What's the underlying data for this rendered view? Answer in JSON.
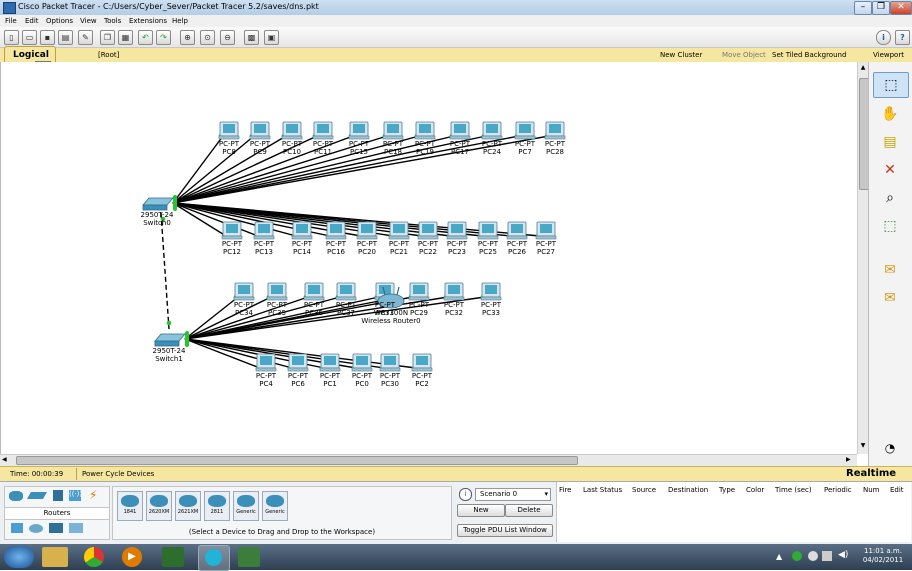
{
  "window": {
    "title": "Cisco Packet Tracer - C:/Users/Cyber_Sever/Packet Tracer 5.2/saves/dns.pkt",
    "controls": [
      "–",
      "❐",
      "✕"
    ]
  },
  "menu": [
    "File",
    "Edit",
    "Options",
    "View",
    "Tools",
    "Extensions",
    "Help"
  ],
  "toolbar": {
    "help_glyph": "?",
    "info_glyph": "i"
  },
  "logical_bar": {
    "tab_label": "Logical",
    "root_label": "[Root]",
    "new_cluster": "New Cluster",
    "move_object": "Move Object",
    "set_tiled_background": "Set Tiled Background",
    "viewport": "Viewport"
  },
  "colors": {
    "link_up": "#22c92b",
    "link_bundle": "#000000",
    "pc_screen": "#4aa8c7",
    "workspace_bar": "#f6e7a0"
  },
  "switches": [
    {
      "id": "s0",
      "line1": "2950T-24",
      "line2": "Switch0"
    },
    {
      "id": "s1",
      "line1": "2950T-24",
      "line2": "Switch1"
    }
  ],
  "router": {
    "line1": "WRT300N",
    "line2": "Wireless Router0"
  },
  "pc_rows": {
    "row1": [
      {
        "type": "PC-PT",
        "name": "PC8"
      },
      {
        "type": "PC-PT",
        "name": "PC9"
      },
      {
        "type": "PC-PT",
        "name": "PC10"
      },
      {
        "type": "PC-PT",
        "name": "PC11"
      },
      {
        "type": "PC-PT",
        "name": "PC15"
      },
      {
        "type": "PC-PT",
        "name": "PC18"
      },
      {
        "type": "PC-PT",
        "name": "PC19"
      },
      {
        "type": "PC-PT",
        "name": "PC17"
      },
      {
        "type": "PC-PT",
        "name": "PC24"
      },
      {
        "type": "PC-PT",
        "name": "PC7"
      },
      {
        "type": "PC-PT",
        "name": "PC28"
      }
    ],
    "row2": [
      {
        "type": "PC-PT",
        "name": "PC12"
      },
      {
        "type": "PC-PT",
        "name": "PC13"
      },
      {
        "type": "PC-PT",
        "name": "PC14"
      },
      {
        "type": "PC-PT",
        "name": "PC16"
      },
      {
        "type": "PC-PT",
        "name": "PC20"
      },
      {
        "type": "PC-PT",
        "name": "PC21"
      },
      {
        "type": "PC-PT",
        "name": "PC22"
      },
      {
        "type": "PC-PT",
        "name": "PC23"
      },
      {
        "type": "PC-PT",
        "name": "PC25"
      },
      {
        "type": "PC-PT",
        "name": "PC26"
      },
      {
        "type": "PC-PT",
        "name": "PC27"
      }
    ],
    "row3": [
      {
        "type": "PC-PT",
        "name": "PC34"
      },
      {
        "type": "PC-PT",
        "name": "PC35"
      },
      {
        "type": "PC-PT",
        "name": "PC36"
      },
      {
        "type": "PC-PT",
        "name": "PC37"
      },
      {
        "type": "PC-PT",
        "name": "PC31"
      },
      {
        "type": "PC-PT",
        "name": "PC29"
      },
      {
        "type": "PC-PT",
        "name": "PC32"
      },
      {
        "type": "PC-PT",
        "name": "PC33"
      }
    ],
    "row4": [
      {
        "type": "PC-PT",
        "name": "PC4"
      },
      {
        "type": "PC-PT",
        "name": "PC6"
      },
      {
        "type": "PC-PT",
        "name": "PC1"
      },
      {
        "type": "PC-PT",
        "name": "PC0"
      },
      {
        "type": "PC-PT",
        "name": "PC30"
      },
      {
        "type": "PC-PT",
        "name": "PC2"
      }
    ]
  },
  "status": {
    "time": "Time: 00:00:39",
    "power_cycle": "Power Cycle Devices",
    "mode": "Realtime"
  },
  "device_panel": {
    "category_label": "Routers",
    "devices": [
      "1841",
      "2620XM",
      "2621XM",
      "2811",
      "Generic",
      "Generic"
    ],
    "hint": "(Select a Device to Drag and Drop to the Workspace)"
  },
  "scenario": {
    "selected": "Scenario 0",
    "new_label": "New",
    "delete_label": "Delete",
    "toggle_label": "Toggle PDU List Window"
  },
  "pdu_columns": [
    "Fire",
    "Last Status",
    "Source",
    "Destination",
    "Type",
    "Color",
    "Time (sec)",
    "Periodic",
    "Num",
    "Edit"
  ],
  "taskbar": {
    "clock_time": "11:01 a.m.",
    "clock_date": "04/02/2011"
  }
}
